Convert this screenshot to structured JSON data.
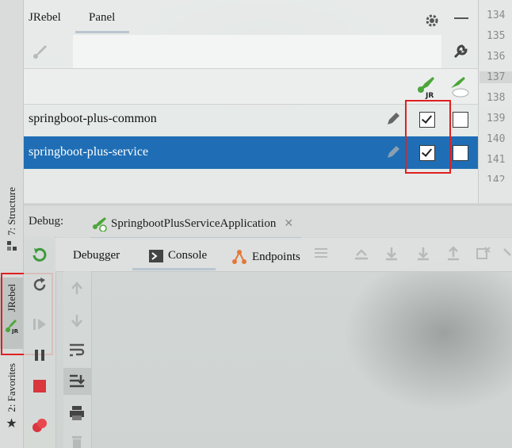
{
  "left_strip": {
    "structure_label": "7: Structure",
    "jrebel_label": "JRebel",
    "favorites_label": "2: Favorites"
  },
  "panel": {
    "tabs": [
      {
        "label": "JRebel"
      },
      {
        "label": "Panel"
      }
    ],
    "active_tab": "Panel",
    "columns": [
      "jrebel-agent-icon",
      "remote-server-icon"
    ],
    "rows": [
      {
        "name": "springboot-plus-common",
        "jrebel_enabled": true,
        "remote_enabled": false,
        "selected": false
      },
      {
        "name": "springboot-plus-service",
        "jrebel_enabled": true,
        "remote_enabled": false,
        "selected": true
      }
    ]
  },
  "gutter": {
    "line_numbers": [
      "134",
      "135",
      "136",
      "137",
      "138",
      "139",
      "140",
      "141",
      "142"
    ],
    "highlighted": "137"
  },
  "debug": {
    "label": "Debug:",
    "session_name": "SpringbootPlusServiceApplication",
    "subtabs": [
      "Debugger",
      "Console",
      "Endpoints"
    ],
    "active_subtab": "Console"
  },
  "colors": {
    "selection": "#1f6eb5",
    "highlight_box": "#e02020",
    "jrebel_green": "#4ca63a",
    "stop_red": "#d9363e"
  }
}
